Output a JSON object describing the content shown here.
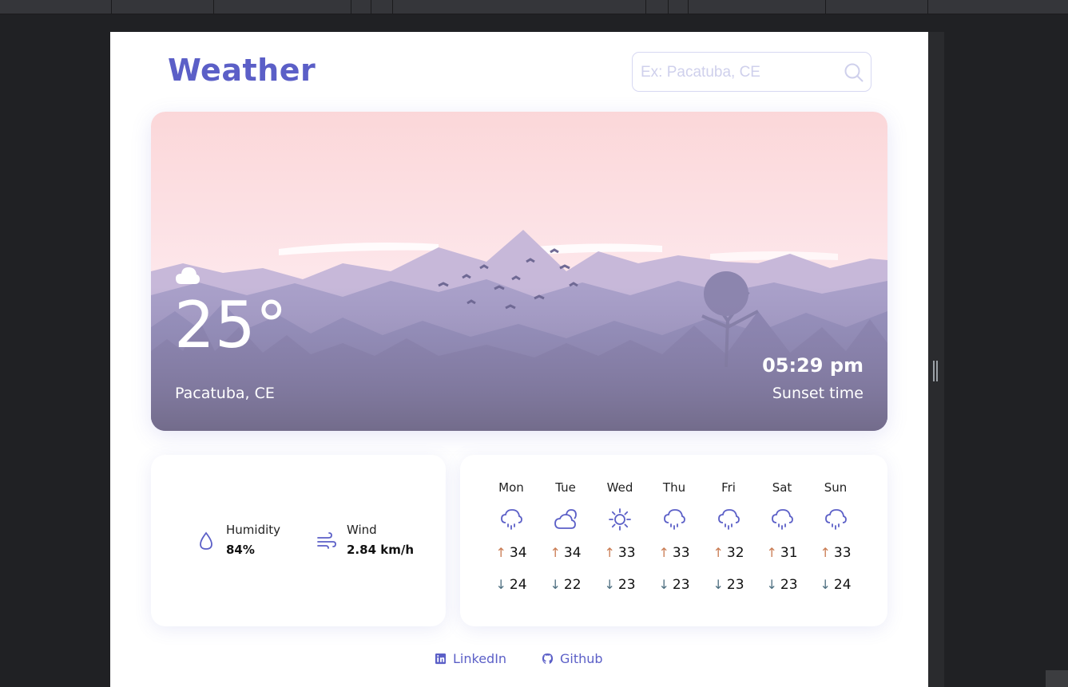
{
  "app": {
    "title": "Weather"
  },
  "search": {
    "placeholder": "Ex: Pacatuba, CE",
    "value": ""
  },
  "current": {
    "icon": "cloud-icon",
    "temperature": "25°",
    "location": "Pacatuba, CE",
    "sunset_time": "05:29 pm",
    "sunset_label": "Sunset time"
  },
  "stats": {
    "humidity": {
      "label": "Humidity",
      "value": "84%",
      "icon": "droplet-icon"
    },
    "wind": {
      "label": "Wind",
      "value": "2.84 km/h",
      "icon": "wind-icon"
    }
  },
  "forecast": [
    {
      "day": "Mon",
      "icon": "cloud-rain-icon",
      "high": "34",
      "low": "24"
    },
    {
      "day": "Tue",
      "icon": "cloud-sun-icon",
      "high": "34",
      "low": "22"
    },
    {
      "day": "Wed",
      "icon": "sun-icon",
      "high": "33",
      "low": "23"
    },
    {
      "day": "Thu",
      "icon": "cloud-rain-icon",
      "high": "33",
      "low": "23"
    },
    {
      "day": "Fri",
      "icon": "cloud-rain-icon",
      "high": "32",
      "low": "23"
    },
    {
      "day": "Sat",
      "icon": "cloud-rain-icon",
      "high": "31",
      "low": "23"
    },
    {
      "day": "Sun",
      "icon": "cloud-rain-icon",
      "high": "33",
      "low": "24"
    }
  ],
  "footer": {
    "linkedin": {
      "label": "LinkedIn",
      "icon": "linkedin-icon"
    },
    "github": {
      "label": "Github",
      "icon": "github-icon"
    }
  },
  "colors": {
    "accent": "#5b5fc7",
    "high_arrow": "#c97b52",
    "low_arrow": "#4e6f80"
  }
}
